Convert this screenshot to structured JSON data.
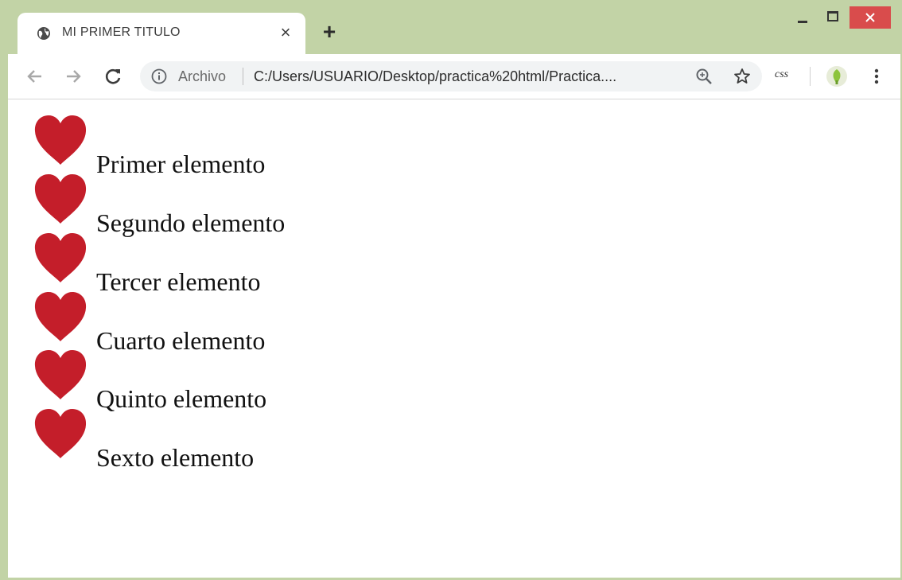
{
  "tab": {
    "title": "MI PRIMER TITULO",
    "icon": "globe-icon",
    "close_label": "×",
    "new_tab_label": "+"
  },
  "window_controls": {
    "close_color": "#d94c4c"
  },
  "address_bar": {
    "scheme_label": "Archivo",
    "url": "C:/Users/USUARIO/Desktop/practica%20html/Practica...."
  },
  "extensions": {
    "css_label": "css"
  },
  "page": {
    "bullet_icon": "heart-icon",
    "bullet_color": "#c41e2a",
    "items": [
      {
        "label": "Primer elemento"
      },
      {
        "label": "Segundo elemento"
      },
      {
        "label": "Tercer elemento"
      },
      {
        "label": "Cuarto elemento"
      },
      {
        "label": "Quinto elemento"
      },
      {
        "label": "Sexto elemento"
      }
    ]
  },
  "colors": {
    "frame": "#c2d3a6",
    "omnibox": "#f1f3f4"
  }
}
